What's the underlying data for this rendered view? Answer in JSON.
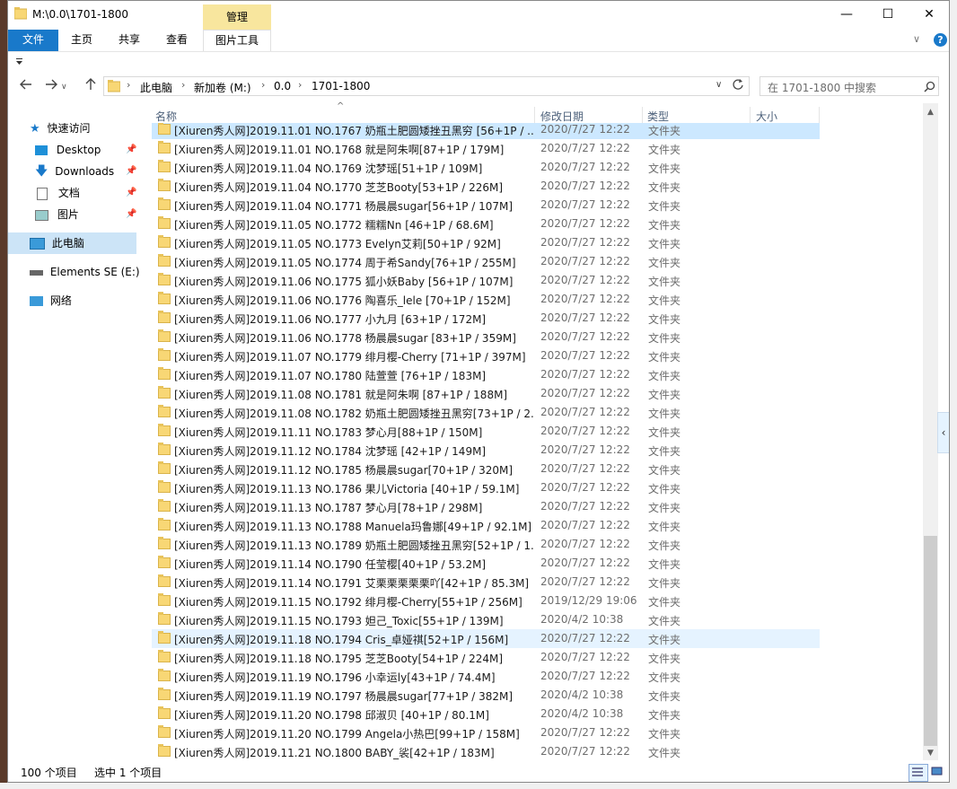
{
  "window": {
    "title_path": "M:\\0.0\\1701-1800",
    "manage_tab": "管理",
    "minimize": "—",
    "maximize": "☐",
    "close": "✕"
  },
  "ribbon": {
    "tabs": [
      "文件",
      "主页",
      "共享",
      "查看",
      "图片工具"
    ],
    "expand_icon": "∨",
    "help_icon": "?"
  },
  "address": {
    "crumbs": [
      "此电脑",
      "新加卷 (M:)",
      "0.0",
      "1701-1800"
    ],
    "search_placeholder": "在 1701-1800 中搜索"
  },
  "nav": {
    "quick_access": "快速访问",
    "items": [
      "Desktop",
      "Downloads",
      "文档",
      "图片"
    ],
    "this_pc": "此电脑",
    "elements": "Elements SE (E:)",
    "network": "网络"
  },
  "columns": {
    "name": "名称",
    "date": "修改日期",
    "type": "类型",
    "size": "大小"
  },
  "files": [
    {
      "name": "[Xiuren秀人网]2019.11.01 NO.1767 奶瓶土肥圆矮挫丑黑穷 [56+1P / ...",
      "date": "2020/7/27 12:22",
      "type": "文件夹"
    },
    {
      "name": "[Xiuren秀人网]2019.11.01 NO.1768 就是阿朱啊[87+1P / 179M]",
      "date": "2020/7/27 12:22",
      "type": "文件夹"
    },
    {
      "name": "[Xiuren秀人网]2019.11.04 NO.1769 沈梦瑶[51+1P / 109M]",
      "date": "2020/7/27 12:22",
      "type": "文件夹"
    },
    {
      "name": "[Xiuren秀人网]2019.11.04 NO.1770 芝芝Booty[53+1P / 226M]",
      "date": "2020/7/27 12:22",
      "type": "文件夹"
    },
    {
      "name": "[Xiuren秀人网]2019.11.04 NO.1771 杨晨晨sugar[56+1P / 107M]",
      "date": "2020/7/27 12:22",
      "type": "文件夹"
    },
    {
      "name": "[Xiuren秀人网]2019.11.05 NO.1772 糯糯Nn [46+1P / 68.6M]",
      "date": "2020/7/27 12:22",
      "type": "文件夹"
    },
    {
      "name": "[Xiuren秀人网]2019.11.05 NO.1773 Evelyn艾莉[50+1P / 92M]",
      "date": "2020/7/27 12:22",
      "type": "文件夹"
    },
    {
      "name": "[Xiuren秀人网]2019.11.05 NO.1774 周于希Sandy[76+1P / 255M]",
      "date": "2020/7/27 12:22",
      "type": "文件夹"
    },
    {
      "name": "[Xiuren秀人网]2019.11.06 NO.1775 狐小妖Baby [56+1P / 107M]",
      "date": "2020/7/27 12:22",
      "type": "文件夹"
    },
    {
      "name": "[Xiuren秀人网]2019.11.06 NO.1776 陶喜乐_lele [70+1P / 152M]",
      "date": "2020/7/27 12:22",
      "type": "文件夹"
    },
    {
      "name": "[Xiuren秀人网]2019.11.06 NO.1777 小九月 [63+1P / 172M]",
      "date": "2020/7/27 12:22",
      "type": "文件夹"
    },
    {
      "name": "[Xiuren秀人网]2019.11.06 NO.1778 杨晨晨sugar [83+1P / 359M]",
      "date": "2020/7/27 12:22",
      "type": "文件夹"
    },
    {
      "name": "[Xiuren秀人网]2019.11.07 NO.1779 绯月樱-Cherry [71+1P / 397M]",
      "date": "2020/7/27 12:22",
      "type": "文件夹"
    },
    {
      "name": "[Xiuren秀人网]2019.11.07 NO.1780 陆萱萱 [76+1P / 183M]",
      "date": "2020/7/27 12:22",
      "type": "文件夹"
    },
    {
      "name": "[Xiuren秀人网]2019.11.08 NO.1781 就是阿朱啊 [87+1P / 188M]",
      "date": "2020/7/27 12:22",
      "type": "文件夹"
    },
    {
      "name": "[Xiuren秀人网]2019.11.08 NO.1782 奶瓶土肥圆矮挫丑黑穷[73+1P / 2...",
      "date": "2020/7/27 12:22",
      "type": "文件夹"
    },
    {
      "name": "[Xiuren秀人网]2019.11.11 NO.1783 梦心月[88+1P / 150M]",
      "date": "2020/7/27 12:22",
      "type": "文件夹"
    },
    {
      "name": "[Xiuren秀人网]2019.11.12 NO.1784 沈梦瑶 [42+1P / 149M]",
      "date": "2020/7/27 12:22",
      "type": "文件夹"
    },
    {
      "name": "[Xiuren秀人网]2019.11.12 NO.1785 杨晨晨sugar[70+1P / 320M]",
      "date": "2020/7/27 12:22",
      "type": "文件夹"
    },
    {
      "name": "[Xiuren秀人网]2019.11.13 NO.1786 果儿Victoria [40+1P / 59.1M]",
      "date": "2020/7/27 12:22",
      "type": "文件夹"
    },
    {
      "name": "[Xiuren秀人网]2019.11.13 NO.1787 梦心月[78+1P / 298M]",
      "date": "2020/7/27 12:22",
      "type": "文件夹"
    },
    {
      "name": "[Xiuren秀人网]2019.11.13 NO.1788 Manuela玛鲁娜[49+1P / 92.1M]",
      "date": "2020/7/27 12:22",
      "type": "文件夹"
    },
    {
      "name": "[Xiuren秀人网]2019.11.13 NO.1789 奶瓶土肥圆矮挫丑黑穷[52+1P / 1...",
      "date": "2020/7/27 12:22",
      "type": "文件夹"
    },
    {
      "name": "[Xiuren秀人网]2019.11.14 NO.1790 任莹樱[40+1P / 53.2M]",
      "date": "2020/7/27 12:22",
      "type": "文件夹"
    },
    {
      "name": "[Xiuren秀人网]2019.11.14 NO.1791 艾栗栗栗栗栗吖[42+1P / 85.3M]",
      "date": "2020/7/27 12:22",
      "type": "文件夹"
    },
    {
      "name": "[Xiuren秀人网]2019.11.15 NO.1792 绯月樱-Cherry[55+1P / 256M]",
      "date": "2019/12/29 19:06",
      "type": "文件夹"
    },
    {
      "name": "[Xiuren秀人网]2019.11.15 NO.1793 妲己_Toxic[55+1P / 139M]",
      "date": "2020/4/2 10:38",
      "type": "文件夹"
    },
    {
      "name": "[Xiuren秀人网]2019.11.18 NO.1794 Cris_卓娅祺[52+1P / 156M]",
      "date": "2020/7/27 12:22",
      "type": "文件夹"
    },
    {
      "name": "[Xiuren秀人网]2019.11.18 NO.1795 芝芝Booty[54+1P / 224M]",
      "date": "2020/7/27 12:22",
      "type": "文件夹"
    },
    {
      "name": "[Xiuren秀人网]2019.11.19 NO.1796 小幸运ly[43+1P / 74.4M]",
      "date": "2020/7/27 12:22",
      "type": "文件夹"
    },
    {
      "name": "[Xiuren秀人网]2019.11.19 NO.1797 杨晨晨sugar[77+1P / 382M]",
      "date": "2020/4/2 10:38",
      "type": "文件夹"
    },
    {
      "name": "[Xiuren秀人网]2019.11.20 NO.1798 邱淑贝 [40+1P / 80.1M]",
      "date": "2020/4/2 10:38",
      "type": "文件夹"
    },
    {
      "name": "[Xiuren秀人网]2019.11.20 NO.1799 Angela小热巴[99+1P / 158M]",
      "date": "2020/7/27 12:22",
      "type": "文件夹"
    },
    {
      "name": "[Xiuren秀人网]2019.11.21 NO.1800 BABY_裟[42+1P / 183M]",
      "date": "2020/7/27 12:22",
      "type": "文件夹"
    }
  ],
  "status": {
    "count": "100 个项目",
    "selected": "选中 1 个项目"
  },
  "icons": {
    "back": "arrow-left-icon",
    "forward": "arrow-right-icon",
    "up": "arrow-up-icon",
    "refresh": "refresh-icon",
    "search": "search-icon",
    "folder_color": "#f8d775",
    "accent": "#1979ca"
  }
}
